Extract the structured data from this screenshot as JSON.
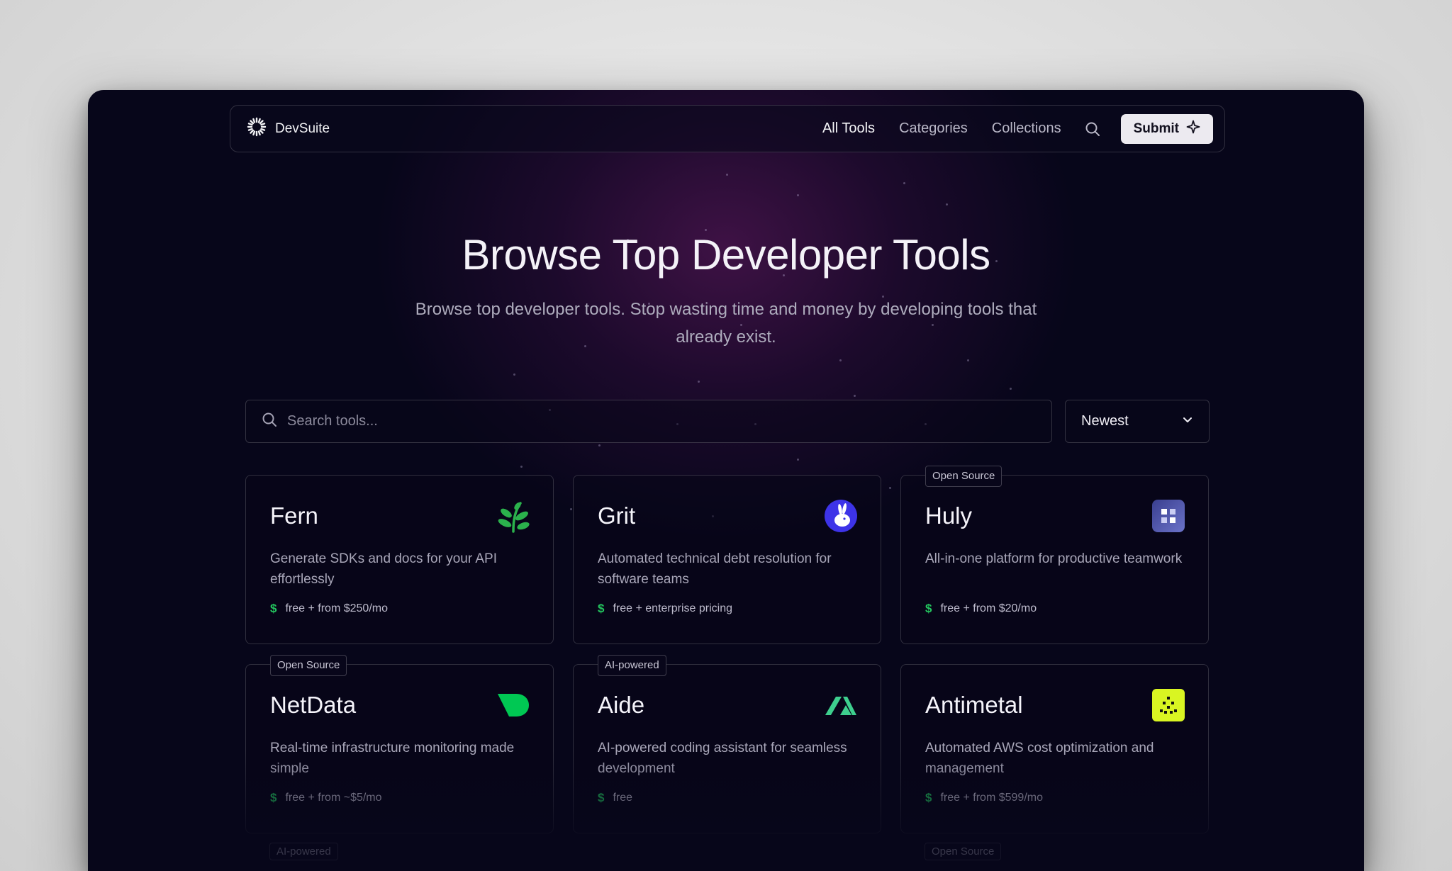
{
  "nav": {
    "brand": "DevSuite",
    "links": [
      "All Tools",
      "Categories",
      "Collections"
    ],
    "submit_label": "Submit"
  },
  "hero": {
    "title": "Browse Top Developer Tools",
    "subtitle": "Browse top developer tools. Stop wasting time and money by developing tools that already exist."
  },
  "search": {
    "placeholder": "Search tools..."
  },
  "sort": {
    "selected": "Newest"
  },
  "tools": [
    {
      "name": "Fern",
      "badge": "",
      "logo": "fern-leaf-icon",
      "description": "Generate SDKs and docs for your API effortlessly",
      "price": "free + from $250/mo"
    },
    {
      "name": "Grit",
      "badge": "",
      "logo": "grit-rabbit-icon",
      "description": "Automated technical debt resolution for software teams",
      "price": "free + enterprise pricing"
    },
    {
      "name": "Huly",
      "badge": "Open Source",
      "logo": "huly-icon",
      "description": "All-in-one platform for productive teamwork",
      "price": "free + from $20/mo"
    },
    {
      "name": "NetData",
      "badge": "Open Source",
      "logo": "netdata-icon",
      "description": "Real-time infrastructure monitoring made simple",
      "price": "free + from ~$5/mo"
    },
    {
      "name": "Aide",
      "badge": "AI-powered",
      "logo": "aide-icon",
      "description": "AI-powered coding assistant for seamless development",
      "price": "free"
    },
    {
      "name": "Antimetal",
      "badge": "",
      "logo": "antimetal-icon",
      "description": "Automated AWS cost optimization and management",
      "price": "free + from $599/mo"
    }
  ],
  "next_row_badges": [
    "AI-powered",
    "Open Source"
  ],
  "colors": {
    "accent_green": "#23c55e",
    "background": "#07061a",
    "glow": "#5c185c"
  }
}
